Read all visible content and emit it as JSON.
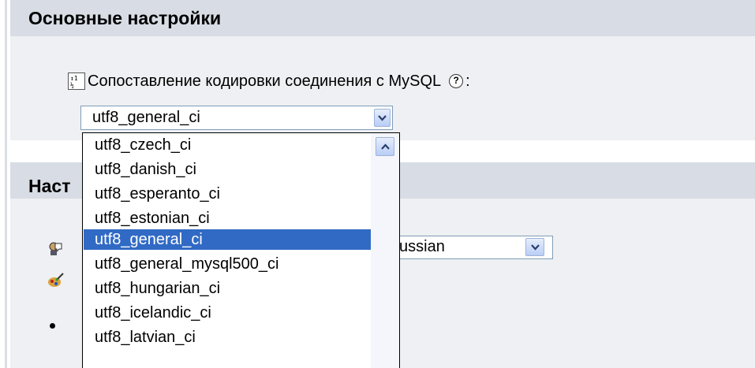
{
  "section1": {
    "title": "Основные настройки",
    "label": "Сопоставление кодировки соединения с MySQL",
    "help_glyph": "?",
    "colon": ":"
  },
  "collation_select": {
    "value": "utf8_general_ci",
    "options": [
      "utf8_czech_ci",
      "utf8_danish_ci",
      "utf8_esperanto_ci",
      "utf8_estonian_ci",
      "utf8_general_ci",
      "utf8_general_mysql500_ci",
      "utf8_hungarian_ci",
      "utf8_icelandic_ci",
      "utf8_latvian_ci"
    ],
    "selected_index": 4
  },
  "section2": {
    "title_partial": "Наст",
    "language_value_partial": "ussian"
  },
  "icons": {
    "sort": "sort-icon",
    "help": "help-icon",
    "dropdown": "chevron-down-icon",
    "scroll_up": "chevron-up-icon",
    "language": "language-icon",
    "theme": "theme-brush-icon",
    "bullet": "bullet-icon"
  },
  "colors": {
    "header_bg": "#d8dde5",
    "body_bg": "#eef0f3",
    "selection": "#316ac5",
    "input_border": "#7f9db9"
  }
}
